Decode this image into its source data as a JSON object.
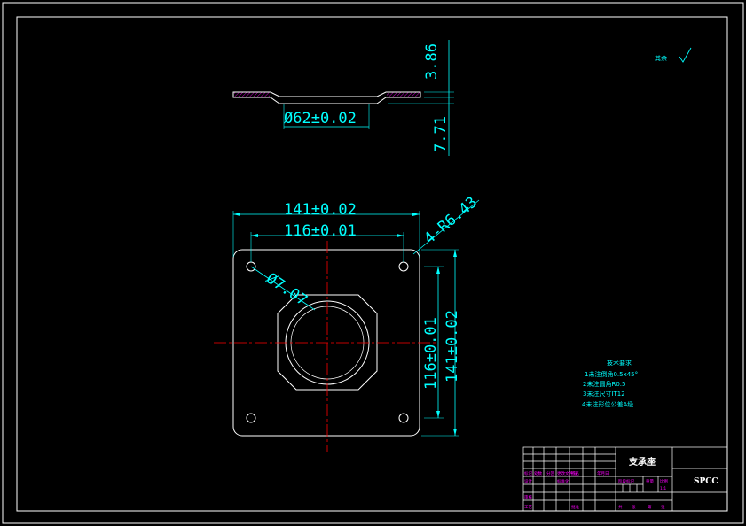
{
  "dimensions": {
    "dia62": "Ø62±0.02",
    "h386": "3.86",
    "h771": "7.71",
    "w141": "141±0.02",
    "w116": "116±0.01",
    "r643": "4-R6.43",
    "d707": "Ø7.07",
    "v116": "116±0.01",
    "v141": "141±0.02"
  },
  "roughness": {
    "label": "其余"
  },
  "tech_req": {
    "title": "技术要求",
    "items": [
      "1未注倒角0.5x45°",
      "2未注圆角R0.5",
      "3未注尺寸IT12",
      "4未注形位公差A级"
    ]
  },
  "title_block": {
    "part_name": "支承座",
    "material": "SPCC",
    "cells": [
      "标记",
      "处数",
      "分区",
      "更改文件号",
      "签名",
      "年月日",
      "设计",
      "标准化",
      "审核",
      "工艺",
      "批准",
      "阶段标记",
      "重量",
      "比例",
      "共",
      "张",
      "第",
      "张",
      "1:1"
    ]
  },
  "colors": {
    "background": "#000000",
    "geometry": "#ffffff",
    "dimension": "#00ffff",
    "centerline": "#ff0000",
    "title_block_text": "#ff00ff",
    "border": "#ffffff"
  }
}
